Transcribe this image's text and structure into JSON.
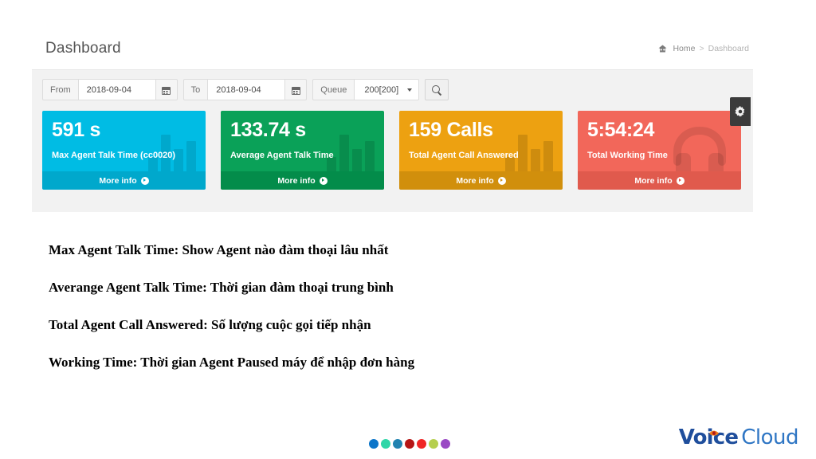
{
  "dashboard": {
    "title": "Dashboard",
    "breadcrumb": {
      "home_icon": "home-icon",
      "home": "Home",
      "separator": ">",
      "current": "Dashboard"
    },
    "toolbar": {
      "from_label": "From",
      "from_value": "2018-09-04",
      "from_calendar_icon": "calendar-icon",
      "to_label": "To",
      "to_value": "2018-09-04",
      "to_calendar_icon": "calendar-icon",
      "queue_label": "Queue",
      "queue_value": "200[200]",
      "search_icon": "magnifier-icon"
    },
    "settings_tab": {
      "icon": "gear-icon"
    },
    "cards": [
      {
        "value": "591 s",
        "label": "Max Agent Talk Time (cc0020)",
        "more_info": "More info",
        "color": "#00bce4",
        "foot_color": "#00a8cc",
        "icon": "bar-chart-icon"
      },
      {
        "value": "133.74 s",
        "label": "Average Agent Talk Time",
        "more_info": "More info",
        "color": "#0aa158",
        "foot_color": "#038c4a",
        "icon": "bar-chart-icon"
      },
      {
        "value": "159 Calls",
        "label": "Total Agent Call Answered",
        "more_info": "More info",
        "color": "#eda111",
        "foot_color": "#d18f0c",
        "icon": "bar-chart-icon"
      },
      {
        "value": "5:54:24",
        "label": "Total Working Time",
        "more_info": "More info",
        "color": "#f2675a",
        "foot_color": "#e05a4d",
        "icon": "headphones-icon"
      }
    ]
  },
  "notes": [
    "Max Agent Talk Time: Show Agent nào đàm thoại lâu nhất",
    "Averange Agent Talk Time: Thời gian đàm thoại trung bình",
    "Total Agent Call Answered: Số lượng cuộc gọi tiếp nhận",
    "Working Time: Thời gian Agent Paused máy để nhập đơn hàng"
  ],
  "footer": {
    "dots": [
      "#0b75c9",
      "#2fd6a8",
      "#2183b0",
      "#b51515",
      "#f02626",
      "#b5cf4e",
      "#9a49c4"
    ],
    "logo": {
      "voice": "Voice",
      "cloud": "Cloud",
      "voice_color": "#1f4e9c",
      "cloud_color": "#2f76c4",
      "flame_color": "#f07818",
      "flame_icon": "flame-eye-icon"
    }
  }
}
